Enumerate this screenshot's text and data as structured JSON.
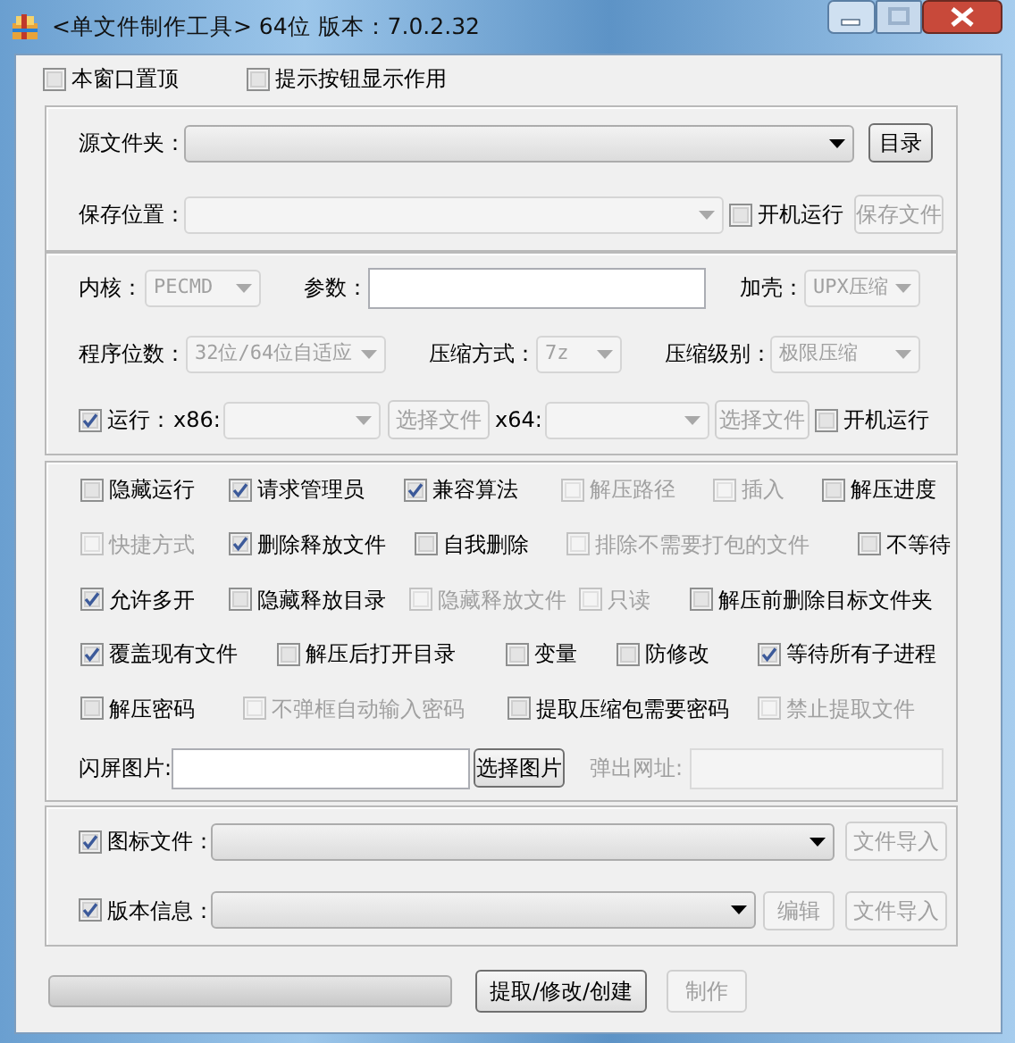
{
  "window": {
    "title": "<单文件制作工具> 64位 版本：7.0.2.32"
  },
  "top_options": [
    {
      "kind": "checkbox",
      "label": "本窗口置顶",
      "checked": false,
      "disabled": false
    },
    {
      "kind": "checkbox",
      "label": "提示按钮显示作用",
      "checked": false,
      "disabled": false
    }
  ],
  "groups": [
    {
      "rows": [
        {
          "items": [
            {
              "kind": "label",
              "text": "源文件夹：",
              "disabled": false
            },
            {
              "kind": "combo",
              "disabled": false
            },
            {
              "kind": "button",
              "label": "目录",
              "disabled": false
            }
          ]
        },
        {
          "items": [
            {
              "kind": "label",
              "text": "保存位置：",
              "disabled": false
            },
            {
              "kind": "combo",
              "disabled": true
            },
            {
              "kind": "checkbox",
              "label": "开机运行",
              "checked": false,
              "disabled": false
            },
            {
              "kind": "button",
              "label": "保存文件",
              "disabled": true
            }
          ]
        }
      ]
    },
    {
      "rows": [
        {
          "items": [
            {
              "kind": "label",
              "text": "内核：",
              "disabled": false
            },
            {
              "kind": "combo",
              "value": "PECMD",
              "disabled": true
            },
            {
              "kind": "label",
              "text": "参数：",
              "disabled": false
            },
            {
              "kind": "input",
              "disabled": false
            },
            {
              "kind": "label",
              "text": "加壳：",
              "disabled": false
            },
            {
              "kind": "combo",
              "value": "UPX压缩",
              "disabled": true
            }
          ]
        },
        {
          "items": [
            {
              "kind": "label",
              "text": "程序位数：",
              "disabled": false
            },
            {
              "kind": "combo",
              "value": "32位/64位自适应",
              "disabled": true
            },
            {
              "kind": "label",
              "text": "压缩方式：",
              "disabled": false
            },
            {
              "kind": "combo",
              "value": "7z",
              "disabled": true
            },
            {
              "kind": "label",
              "text": "压缩级别：",
              "disabled": false
            },
            {
              "kind": "combo",
              "value": "极限压缩",
              "disabled": true
            }
          ]
        },
        {
          "items": [
            {
              "kind": "checkbox",
              "label": "运行：",
              "checked": true,
              "disabled": false
            },
            {
              "kind": "label",
              "text": "x86:",
              "disabled": false
            },
            {
              "kind": "combo",
              "disabled": true
            },
            {
              "kind": "button",
              "label": "选择文件",
              "disabled": true
            },
            {
              "kind": "label",
              "text": "x64:",
              "disabled": false
            },
            {
              "kind": "combo",
              "disabled": true
            },
            {
              "kind": "button",
              "label": "选择文件",
              "disabled": true
            },
            {
              "kind": "checkbox",
              "label": "开机运行",
              "checked": false,
              "disabled": false
            }
          ]
        }
      ]
    },
    {
      "rows": [
        {
          "items": [
            {
              "kind": "checkbox",
              "label": "隐藏运行",
              "checked": false,
              "disabled": false
            },
            {
              "kind": "checkbox",
              "label": "请求管理员",
              "checked": true,
              "disabled": false
            },
            {
              "kind": "checkbox",
              "label": "兼容算法",
              "checked": true,
              "disabled": false
            },
            {
              "kind": "checkbox",
              "label": "解压路径",
              "checked": false,
              "disabled": true
            },
            {
              "kind": "checkbox",
              "label": "插入",
              "checked": false,
              "disabled": true
            },
            {
              "kind": "checkbox",
              "label": "解压进度",
              "checked": false,
              "disabled": false
            }
          ]
        },
        {
          "items": [
            {
              "kind": "checkbox",
              "label": "快捷方式",
              "checked": false,
              "disabled": true
            },
            {
              "kind": "checkbox",
              "label": "删除释放文件",
              "checked": true,
              "disabled": false
            },
            {
              "kind": "checkbox",
              "label": "自我删除",
              "checked": false,
              "disabled": false
            },
            {
              "kind": "checkbox",
              "label": "排除不需要打包的文件",
              "checked": false,
              "disabled": true
            },
            {
              "kind": "checkbox",
              "label": "不等待",
              "checked": false,
              "disabled": false
            }
          ]
        },
        {
          "items": [
            {
              "kind": "checkbox",
              "label": "允许多开",
              "checked": true,
              "disabled": false
            },
            {
              "kind": "checkbox",
              "label": "隐藏释放目录",
              "checked": false,
              "disabled": false
            },
            {
              "kind": "checkbox",
              "label": "隐藏释放文件",
              "checked": false,
              "disabled": true
            },
            {
              "kind": "checkbox",
              "label": "只读",
              "checked": false,
              "disabled": true
            },
            {
              "kind": "checkbox",
              "label": "解压前删除目标文件夹",
              "checked": false,
              "disabled": false
            }
          ]
        },
        {
          "items": [
            {
              "kind": "checkbox",
              "label": "覆盖现有文件",
              "checked": true,
              "disabled": false
            },
            {
              "kind": "checkbox",
              "label": "解压后打开目录",
              "checked": false,
              "disabled": false
            },
            {
              "kind": "checkbox",
              "label": "变量",
              "checked": false,
              "disabled": false
            },
            {
              "kind": "checkbox",
              "label": "防修改",
              "checked": false,
              "disabled": false
            },
            {
              "kind": "checkbox",
              "label": "等待所有子进程",
              "checked": true,
              "disabled": false
            }
          ]
        },
        {
          "items": [
            {
              "kind": "checkbox",
              "label": "解压密码",
              "checked": false,
              "disabled": false
            },
            {
              "kind": "checkbox",
              "label": "不弹框自动输入密码",
              "checked": false,
              "disabled": true
            },
            {
              "kind": "checkbox",
              "label": "提取压缩包需要密码",
              "checked": false,
              "disabled": false
            },
            {
              "kind": "checkbox",
              "label": "禁止提取文件",
              "checked": false,
              "disabled": true
            }
          ]
        },
        {
          "items": [
            {
              "kind": "label",
              "text": "闪屏图片:",
              "disabled": false
            },
            {
              "kind": "input",
              "disabled": false
            },
            {
              "kind": "button",
              "label": "选择图片",
              "disabled": false
            },
            {
              "kind": "label",
              "text": "弹出网址:",
              "disabled": true
            },
            {
              "kind": "input",
              "disabled": true
            }
          ]
        }
      ]
    },
    {
      "rows": [
        {
          "items": [
            {
              "kind": "checkbox",
              "label": "图标文件：",
              "checked": true,
              "disabled": false
            },
            {
              "kind": "combo",
              "disabled": false
            },
            {
              "kind": "button",
              "label": "文件导入",
              "disabled": true
            }
          ]
        },
        {
          "items": [
            {
              "kind": "checkbox",
              "label": "版本信息：",
              "checked": true,
              "disabled": false
            },
            {
              "kind": "combo",
              "disabled": false
            },
            {
              "kind": "button",
              "label": "编辑",
              "disabled": true
            },
            {
              "kind": "button",
              "label": "文件导入",
              "disabled": true
            }
          ]
        }
      ]
    }
  ],
  "bottom": {
    "progress": {
      "level": 0
    },
    "buttons": [
      {
        "label": "提取/修改/创建",
        "disabled": false
      },
      {
        "label": "制作",
        "disabled": true
      }
    ]
  }
}
